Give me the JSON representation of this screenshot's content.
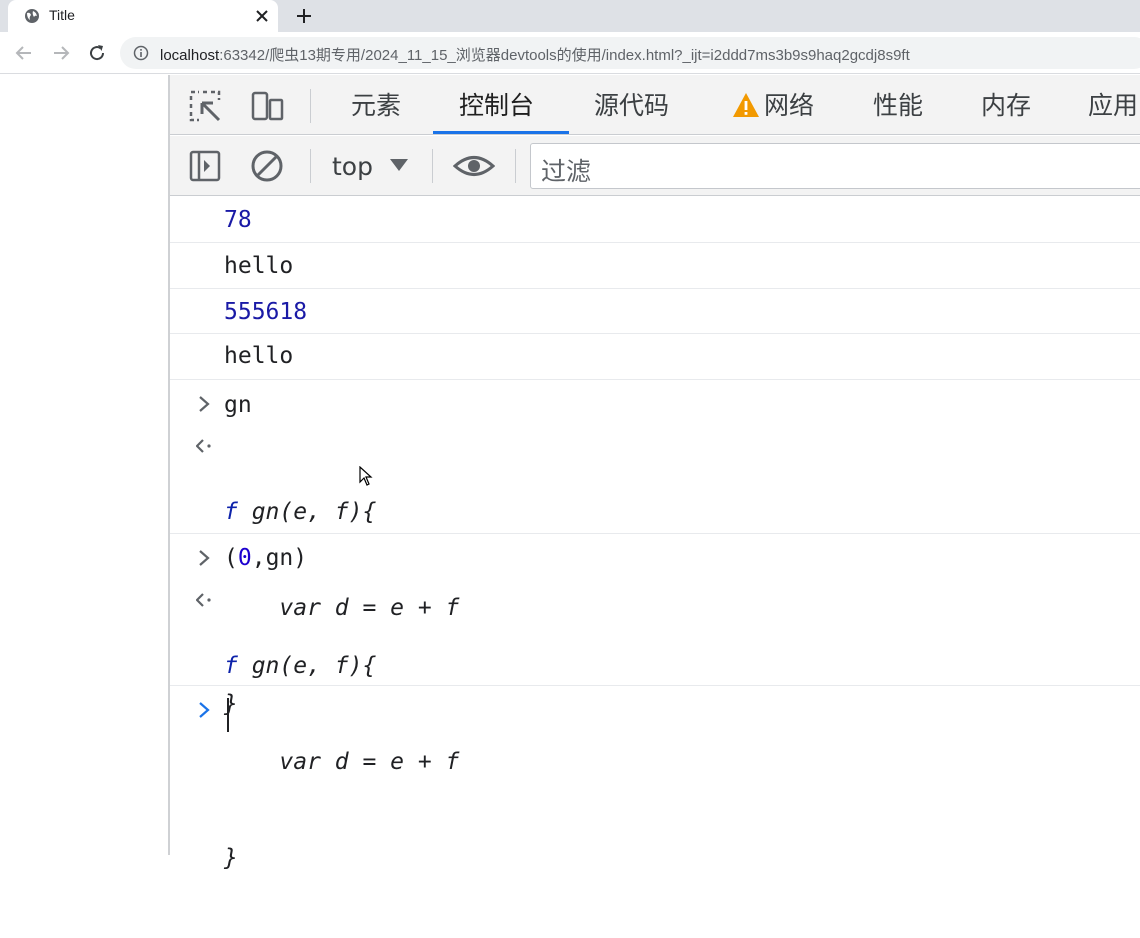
{
  "browser": {
    "tab_title": "Title",
    "url_host": "localhost",
    "url_rest": ":63342/爬虫13期专用/2024_11_15_浏览器devtools的使用/index.html?_ijt=i2ddd7ms3b9s9haq2gcdj8s9ft"
  },
  "devtools": {
    "tabs": [
      {
        "label": "元素"
      },
      {
        "label": "控制台"
      },
      {
        "label": "源代码"
      },
      {
        "label": "网络"
      },
      {
        "label": "性能"
      },
      {
        "label": "内存"
      },
      {
        "label": "应用"
      }
    ],
    "active_tab": "控制台",
    "context": "top",
    "filter_placeholder": "过滤"
  },
  "console": {
    "logs": [
      "78",
      "hello",
      "555618",
      "hello"
    ],
    "entry1_input": "gn",
    "entry1_result": [
      "f gn(e, f){",
      "    var d = e + f",
      "}"
    ],
    "entry2_input_prefix": "(",
    "entry2_input_zero": "0",
    "entry2_input_suffix": ",gn)",
    "entry2_result": [
      "f gn(e, f){",
      "    var d = e + f",
      "}"
    ],
    "fn_keyword": "f",
    "fn_sig": " gn(e, f){",
    "fn_body": "    var d = e + f",
    "fn_close": "}"
  },
  "colors": {
    "accent": "#1a73e8",
    "number": "#1a1aa6",
    "warning": "#f29900"
  }
}
